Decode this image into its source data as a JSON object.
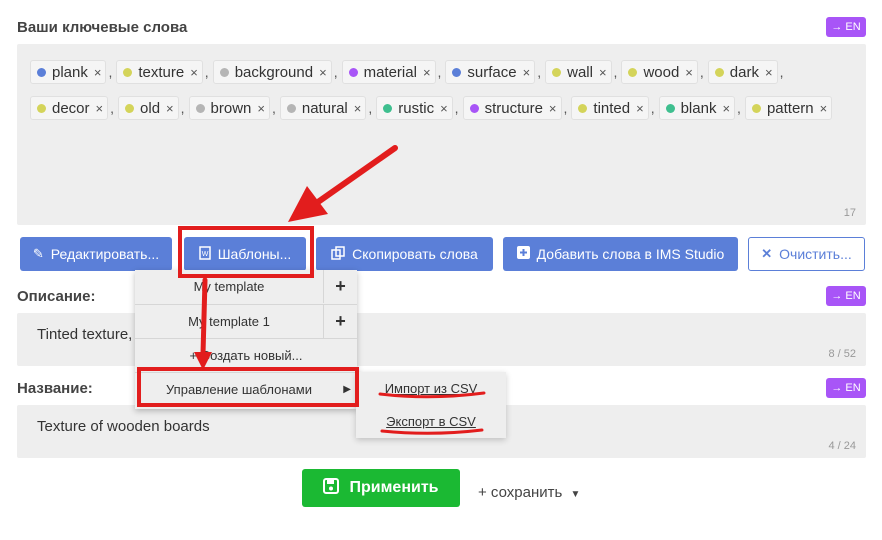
{
  "keywords": {
    "title": "Ваши ключевые слова",
    "lang": "→ EN",
    "count": "17",
    "items": [
      {
        "label": "plank",
        "color": "#5b7fd8"
      },
      {
        "label": "texture",
        "color": "#d4d45a"
      },
      {
        "label": "background",
        "color": "#b5b5b5"
      },
      {
        "label": "material",
        "color": "#a855f7"
      },
      {
        "label": "surface",
        "color": "#5b7fd8"
      },
      {
        "label": "wall",
        "color": "#d4d45a"
      },
      {
        "label": "wood",
        "color": "#d4d45a"
      },
      {
        "label": "dark",
        "color": "#d4d45a"
      },
      {
        "label": "decor",
        "color": "#d4d45a"
      },
      {
        "label": "old",
        "color": "#d4d45a"
      },
      {
        "label": "brown",
        "color": "#b5b5b5"
      },
      {
        "label": "natural",
        "color": "#b5b5b5"
      },
      {
        "label": "rustic",
        "color": "#3fbf8f"
      },
      {
        "label": "structure",
        "color": "#a855f7"
      },
      {
        "label": "tinted",
        "color": "#d4d45a"
      },
      {
        "label": "blank",
        "color": "#3fbf8f"
      },
      {
        "label": "pattern",
        "color": "#d4d45a"
      }
    ]
  },
  "toolbar": {
    "edit": "Редактировать...",
    "templates": "Шаблоны...",
    "copy": "Скопировать слова",
    "add_ims": "Добавить слова в IMS Studio",
    "clear": "Очистить..."
  },
  "templates_menu": {
    "items": [
      "My template",
      "My template 1"
    ],
    "create_new": "+ Создать новый...",
    "manage": "Управление шаблонами",
    "submenu": {
      "import": "Импорт из CSV",
      "export": "Экспорт в CSV"
    }
  },
  "description": {
    "title": "Описание:",
    "lang": "→ EN",
    "text": "Tinted texture, made of rough wooden boards",
    "count": "8 / 52"
  },
  "name": {
    "title": "Название:",
    "lang": "→ EN",
    "text": "Texture of wooden boards",
    "count": "4 / 24"
  },
  "actions": {
    "apply": "Применить",
    "save": "+ сохранить"
  },
  "colors": {
    "primary": "#5b7fd8",
    "accent_purple": "#a855f7",
    "apply_green": "#1bb933",
    "highlight_red": "#e21d1d"
  }
}
